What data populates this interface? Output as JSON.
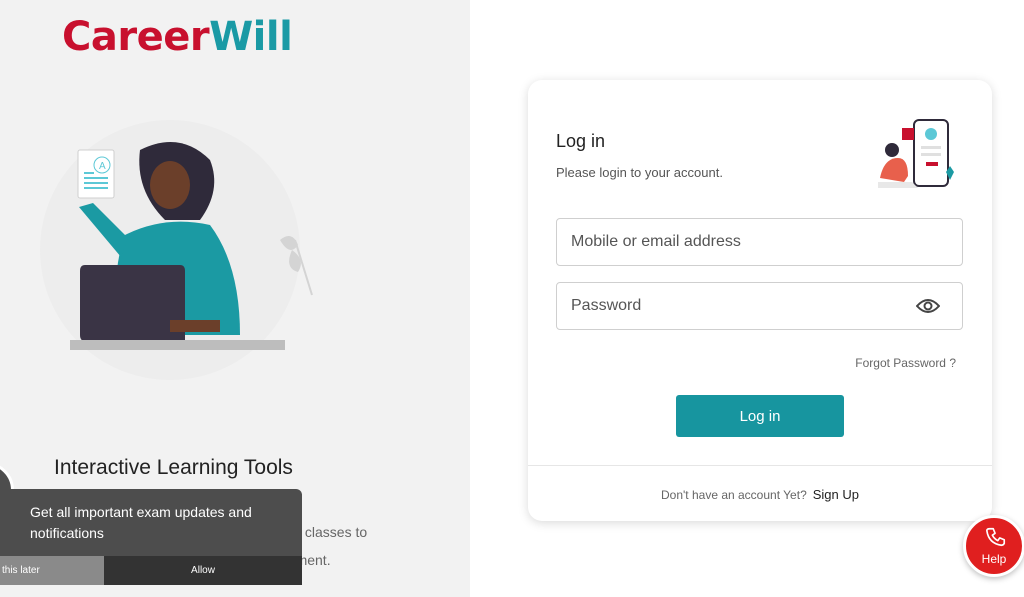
{
  "brand": {
    "part1": "Career",
    "part2": "Will",
    "color_primary": "#c8102e",
    "color_accent": "#1a9aa5"
  },
  "hero": {
    "title": "Interactive Learning Tools",
    "desc_line1": "live classes to",
    "desc_line2": "onment."
  },
  "notification": {
    "message": "Get all important exam updates and notifications",
    "later_label": "this later",
    "allow_label": "Allow"
  },
  "login": {
    "title": "Log in",
    "subtitle": "Please login to your account.",
    "mobile_placeholder": "Mobile or email address",
    "password_placeholder": "Password",
    "forgot_label": "Forgot Password ?",
    "submit_label": "Log in",
    "signup_prompt": "Don't have an account Yet?",
    "signup_label": "Sign Up",
    "accent": "#17959f"
  },
  "help": {
    "label": "Help",
    "color": "#e01f1f",
    "icon": "phone-icon"
  }
}
